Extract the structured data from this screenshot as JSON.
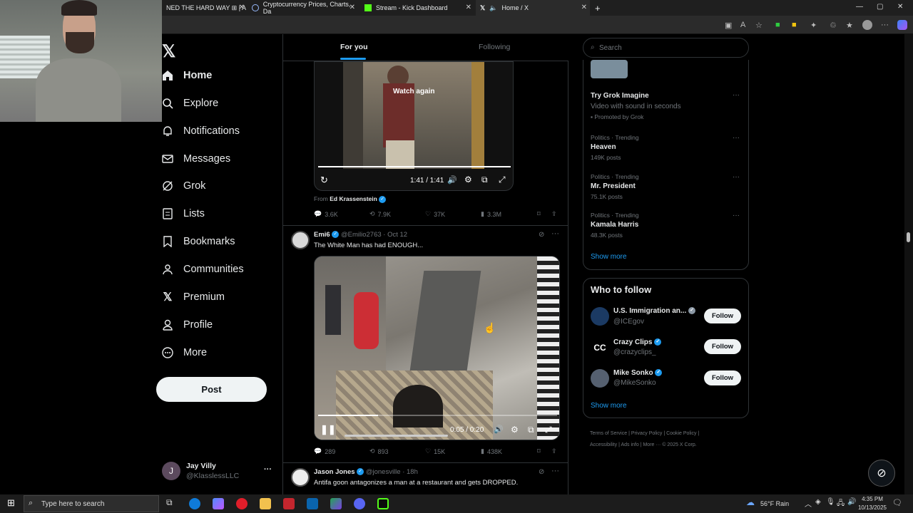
{
  "browser": {
    "tabs": [
      {
        "title": "NED THE HARD WAY ⊞ | A"
      },
      {
        "title": "Cryptocurrency Prices, Charts, Da"
      },
      {
        "title": "Stream - Kick Dashboard"
      },
      {
        "title": "Home / X"
      }
    ],
    "new_tab": "+"
  },
  "sidebar": {
    "items": [
      {
        "label": "Home",
        "icon": "home-icon"
      },
      {
        "label": "Explore",
        "icon": "search-icon"
      },
      {
        "label": "Notifications",
        "icon": "bell-icon"
      },
      {
        "label": "Messages",
        "icon": "mail-icon"
      },
      {
        "label": "Grok",
        "icon": "grok-icon"
      },
      {
        "label": "Lists",
        "icon": "list-icon"
      },
      {
        "label": "Bookmarks",
        "icon": "bookmark-icon"
      },
      {
        "label": "Communities",
        "icon": "people-icon"
      },
      {
        "label": "Premium",
        "icon": "x-icon"
      },
      {
        "label": "Profile",
        "icon": "person-icon"
      },
      {
        "label": "More",
        "icon": "more-circle-icon"
      }
    ],
    "post_label": "Post",
    "account": {
      "initial": "J",
      "name": "Jay Villy",
      "handle": "@KlasslessLLC",
      "more": "···"
    }
  },
  "feed": {
    "tabs": [
      "For you",
      "Following"
    ],
    "post1": {
      "watch_again": "Watch again",
      "time": "1:41 / 1:41",
      "from_label": "From",
      "from_name": "Ed Krassenstein",
      "replies": "3.6K",
      "reposts": "7.9K",
      "likes": "37K",
      "views": "3.3M"
    },
    "post2": {
      "name": "Emi6",
      "handle": "@Emilio2763",
      "date": "· Oct 12",
      "text": "The White Man has had ENOUGH...",
      "time": "0:05 / 0:20",
      "progress": 0.25,
      "replies": "289",
      "reposts": "893",
      "likes": "15K",
      "views": "438K"
    },
    "post3": {
      "name": "Jason Jones",
      "handle": "@jonesville",
      "date": "· 18h",
      "text": "Antifa goon antagonizes a man at a restaurant and gets DROPPED."
    }
  },
  "right": {
    "search_placeholder": "Search",
    "promo": {
      "title": "Try Grok Imagine",
      "desc": "Video with sound in seconds",
      "promoted": "Promoted by Grok"
    },
    "trends": [
      {
        "category": "Politics · Trending",
        "name": "Heaven",
        "posts": "149K posts"
      },
      {
        "category": "Politics · Trending",
        "name": "Mr. President",
        "posts": "75.1K posts"
      },
      {
        "category": "Politics · Trending",
        "name": "Kamala Harris",
        "posts": "48.3K posts"
      }
    ],
    "show_more": "Show more",
    "who_title": "Who to follow",
    "who": [
      {
        "name": "U.S. Immigration an...",
        "handle": "@ICEgov",
        "btn": "Follow"
      },
      {
        "name": "Crazy Clips",
        "handle": "@crazyclips_",
        "btn": "Follow"
      },
      {
        "name": "Mike Sonko",
        "handle": "@MikeSonko",
        "btn": "Follow"
      }
    ],
    "show_more2": "Show more",
    "footer": [
      "Terms of Service",
      "Privacy Policy",
      "Cookie Policy",
      "Accessibility",
      "Ads info",
      "More ···",
      "© 2025 X Corp."
    ]
  },
  "taskbar": {
    "search": "Type here to search",
    "weather": "56°F  Rain",
    "time": "4:35 PM",
    "date": "10/13/2025"
  }
}
